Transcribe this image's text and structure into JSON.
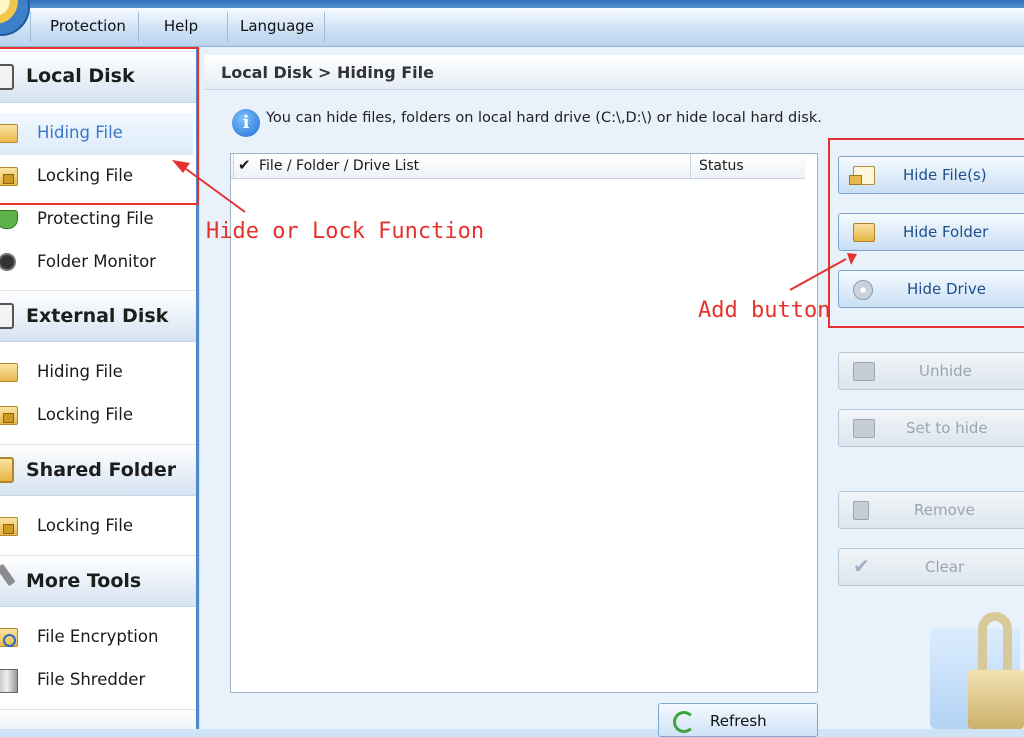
{
  "menubar": {
    "items": [
      "Protection",
      "Help",
      "Language"
    ]
  },
  "sidebar": {
    "sections": [
      {
        "title": "Local Disk",
        "items": [
          "Hiding File",
          "Locking File",
          "Protecting File",
          "Folder Monitor"
        ]
      },
      {
        "title": "External Disk",
        "items": [
          "Hiding File",
          "Locking File"
        ]
      },
      {
        "title": "Shared Folder",
        "items": [
          "Locking File"
        ]
      },
      {
        "title": "More Tools",
        "items": [
          "File Encryption",
          "File Shredder"
        ]
      }
    ],
    "selected": "Local Disk / Hiding File"
  },
  "main": {
    "breadcrumb": "Local Disk > Hiding File",
    "info_text": "You can hide files, folders on local hard drive (C:\\,D:\\) or hide local hard disk.",
    "columns": [
      "File / Folder / Drive List",
      "Status"
    ],
    "refresh_label": "Refresh"
  },
  "actions": {
    "hide_files": "Hide File(s)",
    "hide_folder": "Hide Folder",
    "hide_drive": "Hide Drive",
    "unhide": "Unhide",
    "set_to_hide": "Set to hide",
    "remove": "Remove",
    "clear": "Clear"
  },
  "annotations": {
    "hide_lock": "Hide or Lock Function",
    "add_button": "Add button",
    "color": "#e5322d"
  }
}
